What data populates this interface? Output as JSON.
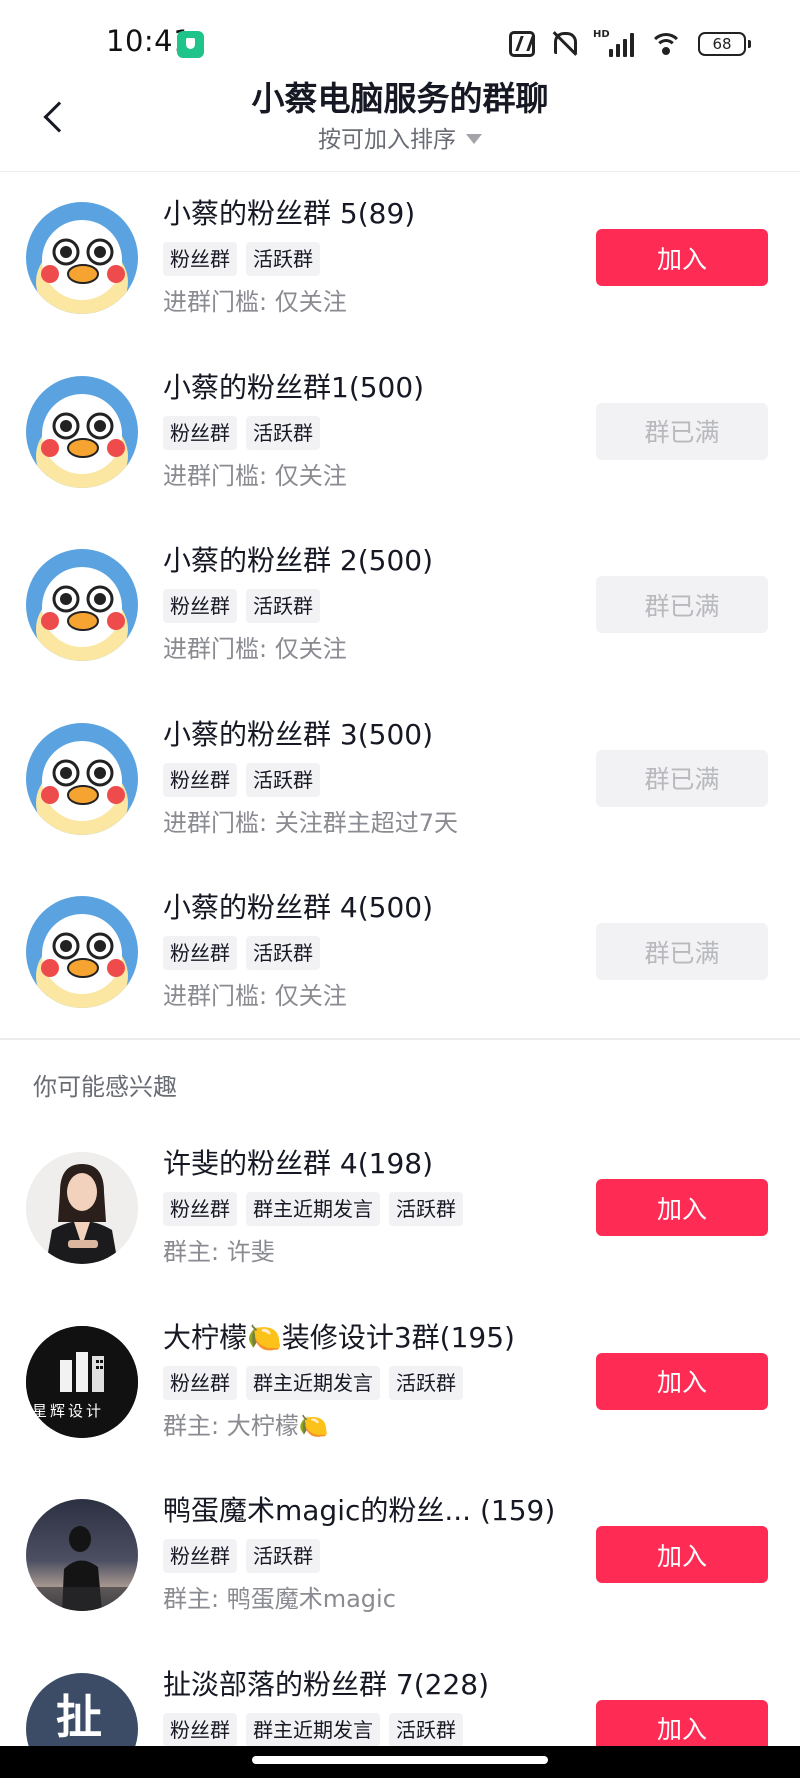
{
  "status_bar": {
    "time": "10:41",
    "hd_label": "HD",
    "battery": "68"
  },
  "header": {
    "title": "小蔡电脑服务的群聊",
    "sort_label": "按可加入排序"
  },
  "my_groups": [
    {
      "name": "小蔡的粉丝群 5(89)",
      "tags": [
        "粉丝群",
        "活跃群"
      ],
      "meta": "进群门槛: 仅关注",
      "action": "加入",
      "action_state": "join"
    },
    {
      "name": "小蔡的粉丝群1(500)",
      "tags": [
        "粉丝群",
        "活跃群"
      ],
      "meta": "进群门槛: 仅关注",
      "action": "群已满",
      "action_state": "full"
    },
    {
      "name": "小蔡的粉丝群 2(500)",
      "tags": [
        "粉丝群",
        "活跃群"
      ],
      "meta": "进群门槛: 仅关注",
      "action": "群已满",
      "action_state": "full"
    },
    {
      "name": "小蔡的粉丝群 3(500)",
      "tags": [
        "粉丝群",
        "活跃群"
      ],
      "meta": "进群门槛: 关注群主超过7天",
      "action": "群已满",
      "action_state": "full"
    },
    {
      "name": "小蔡的粉丝群 4(500)",
      "tags": [
        "粉丝群",
        "活跃群"
      ],
      "meta": "进群门槛: 仅关注",
      "action": "群已满",
      "action_state": "full"
    }
  ],
  "suggested_section_title": "你可能感兴趣",
  "suggested_groups": [
    {
      "name": "许斐的粉丝群 4(198)",
      "tags": [
        "粉丝群",
        "群主近期发言",
        "活跃群"
      ],
      "meta": "群主: 许斐",
      "action": "加入"
    },
    {
      "name": "大柠檬🍋装修设计3群(195)",
      "tags": [
        "粉丝群",
        "群主近期发言",
        "活跃群"
      ],
      "meta": "群主: 大柠檬🍋",
      "action": "加入",
      "avatar_text": "星辉设计"
    },
    {
      "name": "鸭蛋魔术magic的粉丝... (159)",
      "tags": [
        "粉丝群",
        "活跃群"
      ],
      "meta": "群主: 鸭蛋魔术magic",
      "action": "加入"
    },
    {
      "name": "扯淡部落的粉丝群 7(228)",
      "tags": [
        "粉丝群",
        "群主近期发言",
        "活跃群"
      ],
      "meta": "",
      "action": "加入",
      "avatar_text": "扯"
    }
  ],
  "colors": {
    "accent": "#fe2c55",
    "disabled_bg": "#f2f2f4",
    "disabled_text": "#b8b9bd"
  }
}
